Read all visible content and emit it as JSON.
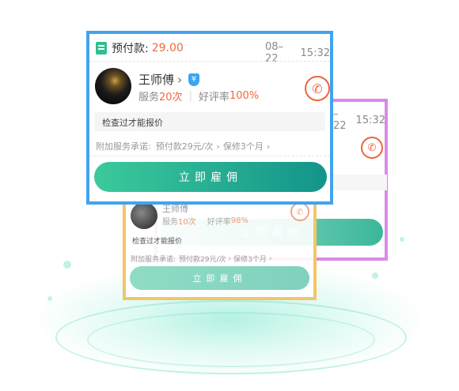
{
  "order": {
    "prepay_label": "预付款:",
    "prepay_amount": "29.00",
    "date": "08–22",
    "time": "15:32",
    "time_back": "15:32",
    "date_back": "–22"
  },
  "worker": {
    "name": "王师傅",
    "name_back": "王师傅",
    "service_prefix": "服务",
    "service_count": "20次",
    "service_count_back": "10次",
    "rating_label": "好评率",
    "rating_value": "100%",
    "rating_value_back": "98%"
  },
  "note": "检查过才能报价",
  "promise": {
    "label": "附加服务承诺:",
    "item1": "预付款29元/次",
    "item2": "保修3个月"
  },
  "hire_button": "立即雇佣",
  "colors": {
    "accent_green": "#2fbf94",
    "orange": "#f06a3b",
    "blue_frame": "#43a3ec",
    "purple_frame": "#d98ae8",
    "yellow_frame": "#f3c568"
  }
}
